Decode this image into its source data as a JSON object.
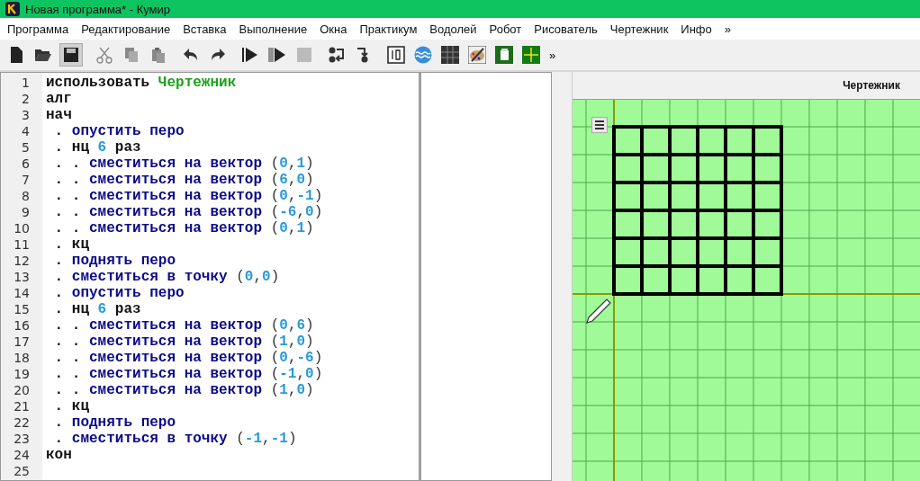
{
  "window": {
    "title": "Новая программа* - Кумир"
  },
  "menu": [
    "Программа",
    "Редактирование",
    "Вставка",
    "Выполнение",
    "Окна",
    "Практикум",
    "Водолей",
    "Робот",
    "Рисователь",
    "Чертежник",
    "Инфо",
    "»"
  ],
  "toolbar": {
    "overflow": "»"
  },
  "editor": {
    "lines": [
      {
        "number": "1",
        "tokens": [
          {
            "text": "использовать ",
            "kind": "kw"
          },
          {
            "text": "Чертежник",
            "kind": "mod"
          }
        ]
      },
      {
        "number": "2",
        "tokens": [
          {
            "text": "алг",
            "kind": "kw"
          }
        ]
      },
      {
        "number": "3",
        "tokens": [
          {
            "text": "нач",
            "kind": "kw"
          }
        ]
      },
      {
        "number": "4",
        "tokens": [
          {
            "text": " . ",
            "kind": "kw"
          },
          {
            "text": "опустить перо",
            "kind": "cmd"
          }
        ]
      },
      {
        "number": "5",
        "tokens": [
          {
            "text": " . нц ",
            "kind": "kw"
          },
          {
            "text": "6",
            "kind": "num"
          },
          {
            "text": " раз",
            "kind": "kw"
          }
        ]
      },
      {
        "number": "6",
        "tokens": [
          {
            "text": " . . ",
            "kind": "kw"
          },
          {
            "text": "сместиться на вектор ",
            "kind": "cmd"
          },
          {
            "text": "(",
            "kind": "sym"
          },
          {
            "text": "0",
            "kind": "num"
          },
          {
            "text": ",",
            "kind": "sym"
          },
          {
            "text": "1",
            "kind": "num"
          },
          {
            "text": ")",
            "kind": "sym"
          }
        ]
      },
      {
        "number": "7",
        "tokens": [
          {
            "text": " . . ",
            "kind": "kw"
          },
          {
            "text": "сместиться на вектор ",
            "kind": "cmd"
          },
          {
            "text": "(",
            "kind": "sym"
          },
          {
            "text": "6",
            "kind": "num"
          },
          {
            "text": ",",
            "kind": "sym"
          },
          {
            "text": "0",
            "kind": "num"
          },
          {
            "text": ")",
            "kind": "sym"
          }
        ]
      },
      {
        "number": "8",
        "tokens": [
          {
            "text": " . . ",
            "kind": "kw"
          },
          {
            "text": "сместиться на вектор ",
            "kind": "cmd"
          },
          {
            "text": "(",
            "kind": "sym"
          },
          {
            "text": "0",
            "kind": "num"
          },
          {
            "text": ",",
            "kind": "sym"
          },
          {
            "text": "-1",
            "kind": "num"
          },
          {
            "text": ")",
            "kind": "sym"
          }
        ]
      },
      {
        "number": "9",
        "tokens": [
          {
            "text": " . . ",
            "kind": "kw"
          },
          {
            "text": "сместиться на вектор ",
            "kind": "cmd"
          },
          {
            "text": "(",
            "kind": "sym"
          },
          {
            "text": "-6",
            "kind": "num"
          },
          {
            "text": ",",
            "kind": "sym"
          },
          {
            "text": "0",
            "kind": "num"
          },
          {
            "text": ")",
            "kind": "sym"
          }
        ]
      },
      {
        "number": "10",
        "tokens": [
          {
            "text": " . . ",
            "kind": "kw"
          },
          {
            "text": "сместиться на вектор ",
            "kind": "cmd"
          },
          {
            "text": "(",
            "kind": "sym"
          },
          {
            "text": "0",
            "kind": "num"
          },
          {
            "text": ",",
            "kind": "sym"
          },
          {
            "text": "1",
            "kind": "num"
          },
          {
            "text": ")",
            "kind": "sym"
          }
        ]
      },
      {
        "number": "11",
        "tokens": [
          {
            "text": " . кц",
            "kind": "kw"
          }
        ]
      },
      {
        "number": "12",
        "tokens": [
          {
            "text": " . ",
            "kind": "kw"
          },
          {
            "text": "поднять перо",
            "kind": "cmd"
          }
        ]
      },
      {
        "number": "13",
        "tokens": [
          {
            "text": " . ",
            "kind": "kw"
          },
          {
            "text": "сместиться в точку ",
            "kind": "cmd"
          },
          {
            "text": "(",
            "kind": "sym"
          },
          {
            "text": "0",
            "kind": "num"
          },
          {
            "text": ",",
            "kind": "sym"
          },
          {
            "text": "0",
            "kind": "num"
          },
          {
            "text": ")",
            "kind": "sym"
          }
        ]
      },
      {
        "number": "14",
        "tokens": [
          {
            "text": " . ",
            "kind": "kw"
          },
          {
            "text": "опустить перо",
            "kind": "cmd"
          }
        ]
      },
      {
        "number": "15",
        "tokens": [
          {
            "text": " . нц ",
            "kind": "kw"
          },
          {
            "text": "6",
            "kind": "num"
          },
          {
            "text": " раз",
            "kind": "kw"
          }
        ]
      },
      {
        "number": "16",
        "tokens": [
          {
            "text": " . . ",
            "kind": "kw"
          },
          {
            "text": "сместиться на вектор ",
            "kind": "cmd"
          },
          {
            "text": "(",
            "kind": "sym"
          },
          {
            "text": "0",
            "kind": "num"
          },
          {
            "text": ",",
            "kind": "sym"
          },
          {
            "text": "6",
            "kind": "num"
          },
          {
            "text": ")",
            "kind": "sym"
          }
        ]
      },
      {
        "number": "17",
        "tokens": [
          {
            "text": " . . ",
            "kind": "kw"
          },
          {
            "text": "сместиться на вектор ",
            "kind": "cmd"
          },
          {
            "text": "(",
            "kind": "sym"
          },
          {
            "text": "1",
            "kind": "num"
          },
          {
            "text": ",",
            "kind": "sym"
          },
          {
            "text": "0",
            "kind": "num"
          },
          {
            "text": ")",
            "kind": "sym"
          }
        ]
      },
      {
        "number": "18",
        "tokens": [
          {
            "text": " . . ",
            "kind": "kw"
          },
          {
            "text": "сместиться на вектор ",
            "kind": "cmd"
          },
          {
            "text": "(",
            "kind": "sym"
          },
          {
            "text": "0",
            "kind": "num"
          },
          {
            "text": ",",
            "kind": "sym"
          },
          {
            "text": "-6",
            "kind": "num"
          },
          {
            "text": ")",
            "kind": "sym"
          }
        ]
      },
      {
        "number": "19",
        "tokens": [
          {
            "text": " . . ",
            "kind": "kw"
          },
          {
            "text": "сместиться на вектор ",
            "kind": "cmd"
          },
          {
            "text": "(",
            "kind": "sym"
          },
          {
            "text": "-1",
            "kind": "num"
          },
          {
            "text": ",",
            "kind": "sym"
          },
          {
            "text": "0",
            "kind": "num"
          },
          {
            "text": ")",
            "kind": "sym"
          }
        ]
      },
      {
        "number": "20",
        "tokens": [
          {
            "text": " . . ",
            "kind": "kw"
          },
          {
            "text": "сместиться на вектор ",
            "kind": "cmd"
          },
          {
            "text": "(",
            "kind": "sym"
          },
          {
            "text": "1",
            "kind": "num"
          },
          {
            "text": ",",
            "kind": "sym"
          },
          {
            "text": "0",
            "kind": "num"
          },
          {
            "text": ")",
            "kind": "sym"
          }
        ]
      },
      {
        "number": "21",
        "tokens": [
          {
            "text": " . кц",
            "kind": "kw"
          }
        ]
      },
      {
        "number": "22",
        "tokens": [
          {
            "text": " . ",
            "kind": "kw"
          },
          {
            "text": "поднять перо",
            "kind": "cmd"
          }
        ]
      },
      {
        "number": "23",
        "tokens": [
          {
            "text": " . ",
            "kind": "kw"
          },
          {
            "text": "сместиться в точку ",
            "kind": "cmd"
          },
          {
            "text": "(",
            "kind": "sym"
          },
          {
            "text": "-1",
            "kind": "num"
          },
          {
            "text": ",",
            "kind": "sym"
          },
          {
            "text": "-1",
            "kind": "num"
          },
          {
            "text": ")",
            "kind": "sym"
          }
        ]
      },
      {
        "number": "24",
        "tokens": [
          {
            "text": "кон",
            "kind": "kw"
          }
        ]
      },
      {
        "number": "25"
      }
    ]
  },
  "drawer": {
    "title": "Чертежник"
  }
}
